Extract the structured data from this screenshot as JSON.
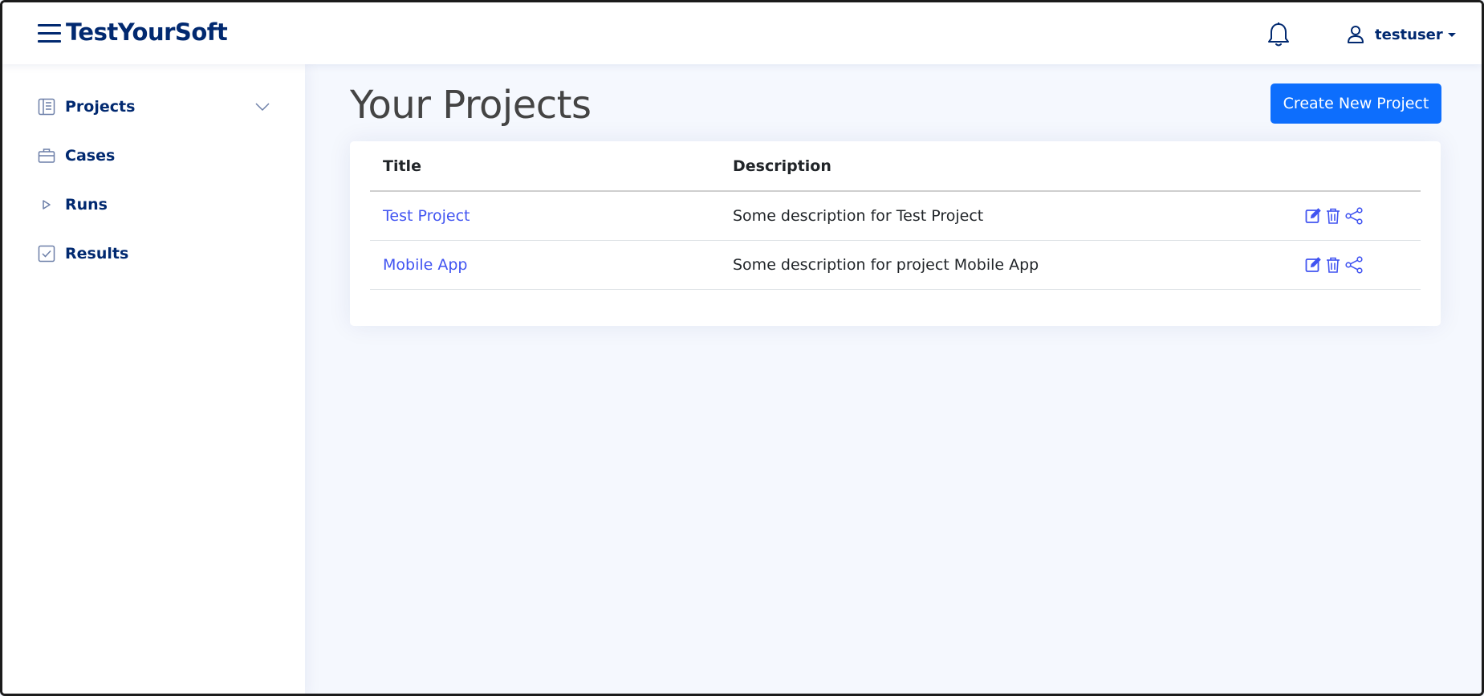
{
  "header": {
    "brand": "TestYourSoft",
    "username": "testuser",
    "icons": {
      "menu": "hamburger-icon",
      "notifications": "bell-icon",
      "user": "person-icon",
      "caret": "caret-down-icon"
    }
  },
  "sidebar": {
    "items": [
      {
        "label": "Projects",
        "icon": "layout-text-sidebar-icon",
        "expandable": true
      },
      {
        "label": "Cases",
        "icon": "briefcase-icon"
      },
      {
        "label": "Runs",
        "icon": "play-triangle-icon"
      },
      {
        "label": "Results",
        "icon": "check-square-icon"
      }
    ]
  },
  "main": {
    "title": "Your Projects",
    "create_button": "Create New Project",
    "table": {
      "columns": [
        "Title",
        "Description",
        ""
      ],
      "rows": [
        {
          "title": "Test Project",
          "description": "Some description for Test Project"
        },
        {
          "title": "Mobile App",
          "description": "Some description for project Mobile App"
        }
      ],
      "row_actions": [
        "edit-icon",
        "trash-icon",
        "share-icon"
      ]
    }
  },
  "colors": {
    "brand": "#012970",
    "link": "#4154f1",
    "button": "#0d6efd",
    "background": "#f5f8fe"
  }
}
